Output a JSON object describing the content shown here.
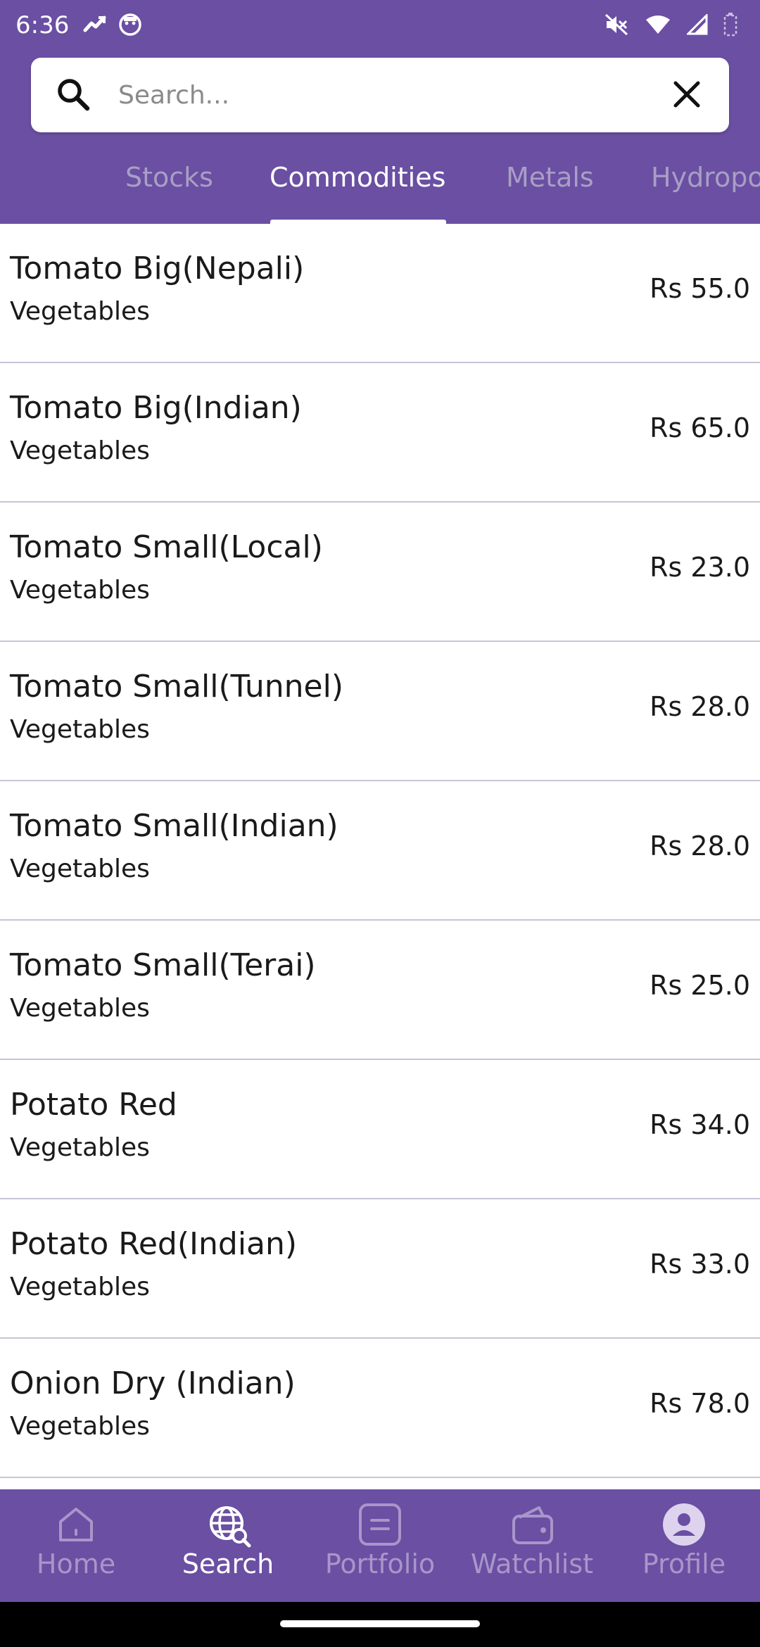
{
  "status_bar": {
    "time": "6:36",
    "left_icons": [
      "trend-icon",
      "face-icon"
    ],
    "right_icons": [
      "mute-icon",
      "wifi-icon",
      "signal-icon",
      "battery-icon"
    ]
  },
  "search": {
    "placeholder": "Search...",
    "value": ""
  },
  "tabs": [
    {
      "label": "Stocks",
      "active": false
    },
    {
      "label": "Commodities",
      "active": true
    },
    {
      "label": "Metals",
      "active": false
    },
    {
      "label": "Hydropo",
      "active": false
    }
  ],
  "items": [
    {
      "name": "Tomato Big(Nepali)",
      "category": "Vegetables",
      "price": "Rs 55.0"
    },
    {
      "name": "Tomato Big(Indian)",
      "category": "Vegetables",
      "price": "Rs 65.0"
    },
    {
      "name": "Tomato Small(Local)",
      "category": "Vegetables",
      "price": "Rs 23.0"
    },
    {
      "name": "Tomato Small(Tunnel)",
      "category": "Vegetables",
      "price": "Rs 28.0"
    },
    {
      "name": "Tomato Small(Indian)",
      "category": "Vegetables",
      "price": "Rs 28.0"
    },
    {
      "name": "Tomato Small(Terai)",
      "category": "Vegetables",
      "price": "Rs 25.0"
    },
    {
      "name": "Potato Red",
      "category": "Vegetables",
      "price": "Rs 34.0"
    },
    {
      "name": "Potato Red(Indian)",
      "category": "Vegetables",
      "price": "Rs 33.0"
    },
    {
      "name": "Onion Dry (Indian)",
      "category": "Vegetables",
      "price": "Rs 78.0"
    }
  ],
  "bottom_nav": [
    {
      "label": "Home",
      "icon": "home-icon",
      "active": false
    },
    {
      "label": "Search",
      "icon": "globe-search-icon",
      "active": true
    },
    {
      "label": "Portfolio",
      "icon": "portfolio-icon",
      "active": false
    },
    {
      "label": "Watchlist",
      "icon": "wallet-icon",
      "active": false
    },
    {
      "label": "Profile",
      "icon": "profile-icon",
      "active": false
    }
  ],
  "colors": {
    "primary": "#6a4fa3",
    "tab_inactive": "#a89fc4",
    "nav_inactive": "#a996c9",
    "divider": "#c8c4d6"
  }
}
